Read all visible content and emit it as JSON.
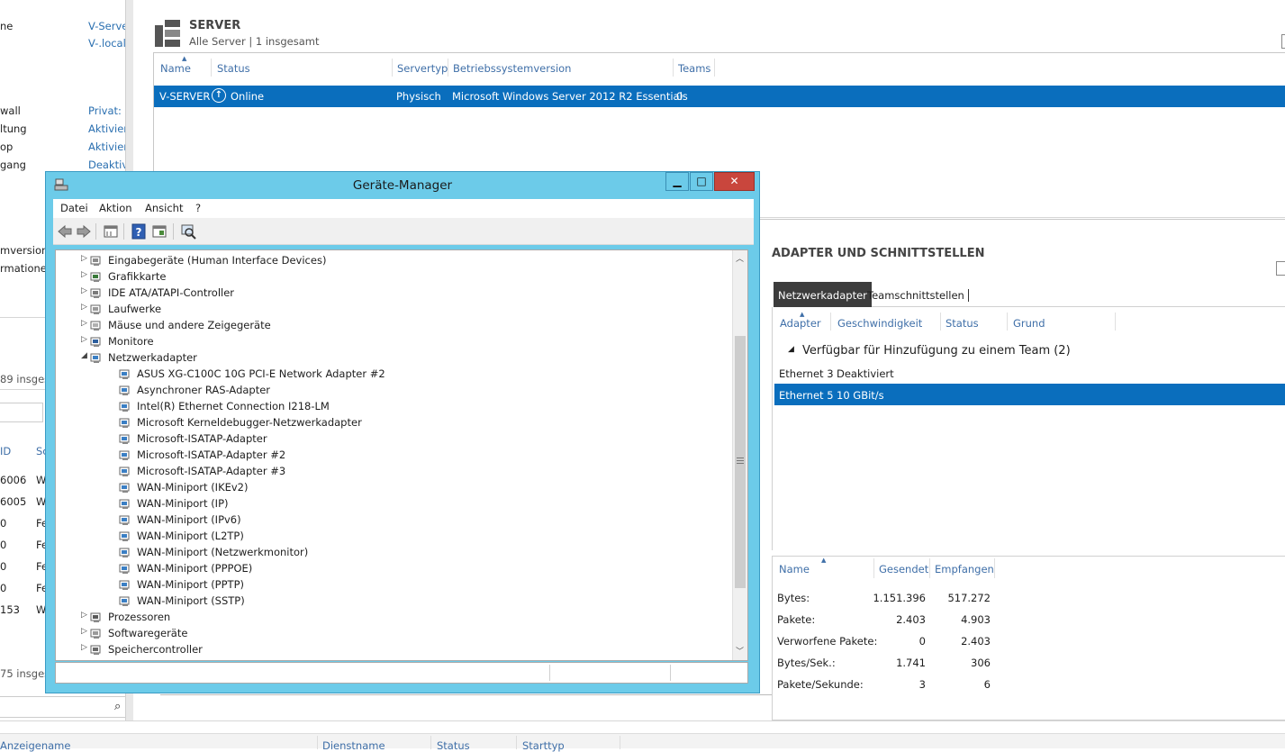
{
  "left_panel": {
    "rows": [
      {
        "label": "ne",
        "value": "V-Serve"
      },
      {
        "label": "",
        "value": "V-.local"
      },
      {
        "label": "wall",
        "value": "Privat: E"
      },
      {
        "label": "ltung",
        "value": "Aktivier"
      },
      {
        "label": "op",
        "value": "Aktivier"
      },
      {
        "label": "gang",
        "value": "Deaktiv"
      }
    ],
    "labels2": [
      "mversion",
      "rmationen"
    ],
    "count1": "89 insges",
    "table_headers": [
      "ID",
      "Sc"
    ],
    "table_rows": [
      {
        "id": "6006",
        "s": "W"
      },
      {
        "id": "6005",
        "s": "W"
      },
      {
        "id": "0",
        "s": "Fe"
      },
      {
        "id": "0",
        "s": "Fe"
      },
      {
        "id": "0",
        "s": "Fe"
      },
      {
        "id": "0",
        "s": "Fe"
      },
      {
        "id": "153",
        "s": "W"
      }
    ],
    "count2": "75 insges"
  },
  "services_header": {
    "columns": [
      "Anzeigename",
      "Dienstname",
      "Status",
      "Starttyp"
    ]
  },
  "server": {
    "title": "SERVER",
    "subtitle": "Alle Server | 1 insgesamt",
    "columns": [
      "Name",
      "Status",
      "Servertyp",
      "Betriebssystemversion",
      "Teams"
    ],
    "row": {
      "name": "V-SERVER",
      "status": "Online",
      "type": "Physisch",
      "os": "Microsoft Windows Server 2012 R2 Essentials",
      "teams": "0"
    }
  },
  "adapters": {
    "title": "ADAPTER UND SCHNITTSTELLEN",
    "tabs": [
      "Netzwerkadapter",
      "Teamschnittstellen"
    ],
    "columns": [
      "Adapter",
      "Geschwindigkeit",
      "Status",
      "Grund"
    ],
    "group": "Verfügbar für Hinzufügung zu einem Team (2)",
    "rows": [
      {
        "adapter": "Ethernet 3",
        "speed": "Deaktiviert",
        "selected": false
      },
      {
        "adapter": "Ethernet 5",
        "speed": "10 GBit/s",
        "selected": true
      }
    ],
    "stats": {
      "columns": [
        "Name",
        "Gesendet",
        "Empfangen"
      ],
      "rows": [
        {
          "name": "Bytes:",
          "sent": "1.151.396",
          "recv": "517.272"
        },
        {
          "name": "Pakete:",
          "sent": "2.403",
          "recv": "4.903"
        },
        {
          "name": "Verworfene Pakete:",
          "sent": "0",
          "recv": "2.403"
        },
        {
          "name": "Bytes/Sek.:",
          "sent": "1.741",
          "recv": "306"
        },
        {
          "name": "Pakete/Sekunde:",
          "sent": "3",
          "recv": "6"
        }
      ]
    }
  },
  "devmgr": {
    "title": "Geräte-Manager",
    "menu": [
      "Datei",
      "Aktion",
      "Ansicht",
      "?"
    ],
    "tree": [
      {
        "label": "Eingabegeräte (Human Interface Devices)",
        "level": 0,
        "exp": "▷",
        "icon": "hid-icon"
      },
      {
        "label": "Grafikkarte",
        "level": 0,
        "exp": "▷",
        "icon": "display-adapter-icon"
      },
      {
        "label": "IDE ATA/ATAPI-Controller",
        "level": 0,
        "exp": "▷",
        "icon": "ide-controller-icon"
      },
      {
        "label": "Laufwerke",
        "level": 0,
        "exp": "▷",
        "icon": "disk-drive-icon"
      },
      {
        "label": "Mäuse und andere Zeigegeräte",
        "level": 0,
        "exp": "▷",
        "icon": "mouse-icon"
      },
      {
        "label": "Monitore",
        "level": 0,
        "exp": "▷",
        "icon": "monitor-icon"
      },
      {
        "label": "Netzwerkadapter",
        "level": 0,
        "exp": "◢",
        "icon": "network-adapter-icon"
      },
      {
        "label": "ASUS XG-C100C 10G PCI-E Network Adapter #2",
        "level": 1,
        "exp": "",
        "icon": "network-adapter-icon"
      },
      {
        "label": "Asynchroner RAS-Adapter",
        "level": 1,
        "exp": "",
        "icon": "network-adapter-icon"
      },
      {
        "label": "Intel(R) Ethernet Connection I218-LM",
        "level": 1,
        "exp": "",
        "icon": "network-adapter-disabled-icon"
      },
      {
        "label": "Microsoft Kerneldebugger-Netzwerkadapter",
        "level": 1,
        "exp": "",
        "icon": "network-adapter-icon"
      },
      {
        "label": "Microsoft-ISATAP-Adapter",
        "level": 1,
        "exp": "",
        "icon": "network-adapter-icon"
      },
      {
        "label": "Microsoft-ISATAP-Adapter #2",
        "level": 1,
        "exp": "",
        "icon": "network-adapter-icon"
      },
      {
        "label": "Microsoft-ISATAP-Adapter #3",
        "level": 1,
        "exp": "",
        "icon": "network-adapter-icon"
      },
      {
        "label": "WAN-Miniport (IKEv2)",
        "level": 1,
        "exp": "",
        "icon": "network-adapter-icon"
      },
      {
        "label": "WAN-Miniport (IP)",
        "level": 1,
        "exp": "",
        "icon": "network-adapter-icon"
      },
      {
        "label": "WAN-Miniport (IPv6)",
        "level": 1,
        "exp": "",
        "icon": "network-adapter-icon"
      },
      {
        "label": "WAN-Miniport (L2TP)",
        "level": 1,
        "exp": "",
        "icon": "network-adapter-icon"
      },
      {
        "label": "WAN-Miniport (Netzwerkmonitor)",
        "level": 1,
        "exp": "",
        "icon": "network-adapter-icon"
      },
      {
        "label": "WAN-Miniport (PPPOE)",
        "level": 1,
        "exp": "",
        "icon": "network-adapter-icon"
      },
      {
        "label": "WAN-Miniport (PPTP)",
        "level": 1,
        "exp": "",
        "icon": "network-adapter-icon"
      },
      {
        "label": "WAN-Miniport (SSTP)",
        "level": 1,
        "exp": "",
        "icon": "network-adapter-icon"
      },
      {
        "label": "Prozessoren",
        "level": 0,
        "exp": "▷",
        "icon": "processor-icon"
      },
      {
        "label": "Softwaregeräte",
        "level": 0,
        "exp": "▷",
        "icon": "software-device-icon"
      },
      {
        "label": "Speichercontroller",
        "level": 0,
        "exp": "▷",
        "icon": "storage-controller-icon"
      }
    ]
  },
  "colors": {
    "selection": "#0a6ebd",
    "title_bar": "#6ccbe9",
    "close_button": "#c9463d",
    "header_text": "#3f6fa8"
  }
}
